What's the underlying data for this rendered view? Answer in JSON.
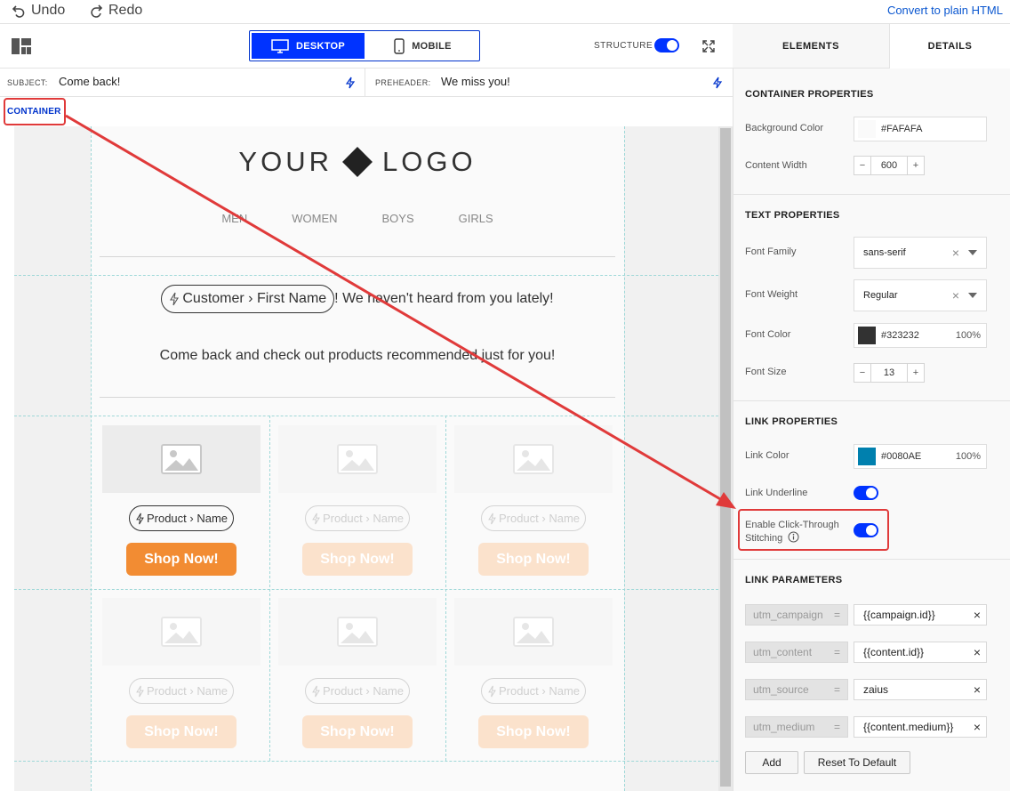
{
  "topbar": {
    "undo": "Undo",
    "redo": "Redo",
    "convert": "Convert to plain HTML"
  },
  "toolbar": {
    "desktop": "DESKTOP",
    "mobile": "MOBILE",
    "structure": "STRUCTURE"
  },
  "subject": {
    "label": "SUBJECT:",
    "value": "Come back!"
  },
  "preheader": {
    "label": "PREHEADER:",
    "value": "We miss you!"
  },
  "container_tag": "CONTAINER",
  "email": {
    "logo_left": "YOUR",
    "logo_right": "LOGO",
    "nav": [
      "MEN",
      "WOMEN",
      "BOYS",
      "GIRLS"
    ],
    "greeting_pill": "Customer › First Name",
    "greeting_rest": "! We haven't heard from you lately!",
    "come_back": "Come back and check out products recommended just for you!",
    "product_pill": "Product › Name",
    "shop_label": "Shop Now!"
  },
  "tabs": {
    "elements": "ELEMENTS",
    "details": "DETAILS"
  },
  "panel": {
    "container": {
      "title": "CONTAINER PROPERTIES",
      "bg_label": "Background Color",
      "bg_value": "#FAFAFA",
      "bg_color": "#FAFAFA",
      "width_label": "Content Width",
      "width_value": "600"
    },
    "text": {
      "title": "TEXT PROPERTIES",
      "family_label": "Font Family",
      "family_value": "sans-serif",
      "weight_label": "Font Weight",
      "weight_value": "Regular",
      "color_label": "Font Color",
      "color_value": "#323232",
      "color_pct": "100%",
      "color_hex": "#323232",
      "size_label": "Font Size",
      "size_value": "13"
    },
    "link": {
      "title": "LINK PROPERTIES",
      "color_label": "Link Color",
      "color_value": "#0080AE",
      "color_pct": "100%",
      "color_hex": "#0080AE",
      "underline_label": "Link Underline",
      "stitch_label_1": "Enable Click-Through",
      "stitch_label_2": "Stitching"
    },
    "params": {
      "title": "LINK PARAMETERS",
      "eq": "=",
      "rows": [
        {
          "key": "utm_campaign",
          "value": "{{campaign.id}}"
        },
        {
          "key": "utm_content",
          "value": "{{content.id}}"
        },
        {
          "key": "utm_source",
          "value": "zaius"
        },
        {
          "key": "utm_medium",
          "value": "{{content.medium}}"
        }
      ],
      "add": "Add",
      "reset": "Reset To Default"
    }
  },
  "colors": {
    "accent": "#0033ff",
    "shop": "#f28c33",
    "annotation": "#e03a3a"
  }
}
